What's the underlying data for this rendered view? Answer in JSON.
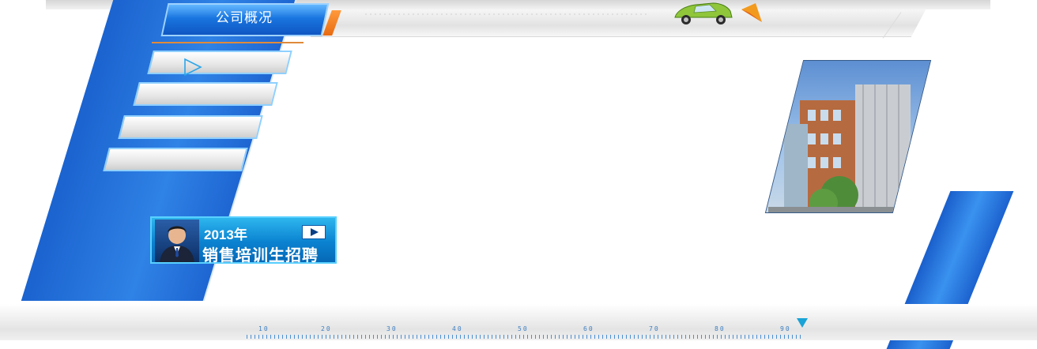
{
  "header": {
    "section_title": "公司概况"
  },
  "sidebar": {
    "items": [
      {
        "label": "",
        "active": true
      },
      {
        "label": ""
      },
      {
        "label": ""
      },
      {
        "label": ""
      }
    ]
  },
  "banner": {
    "year": "2013年",
    "title": "销售培训生招聘",
    "icons": [
      "person-portrait-icon",
      "play-icon"
    ]
  },
  "ruler": {
    "labels": [
      "10",
      "20",
      "30",
      "40",
      "50",
      "60",
      "70",
      "80",
      "90"
    ]
  },
  "colors": {
    "primary_blue": "#1e6ad6",
    "accent_cyan": "#59d0ff",
    "accent_orange": "#e08a3a"
  }
}
